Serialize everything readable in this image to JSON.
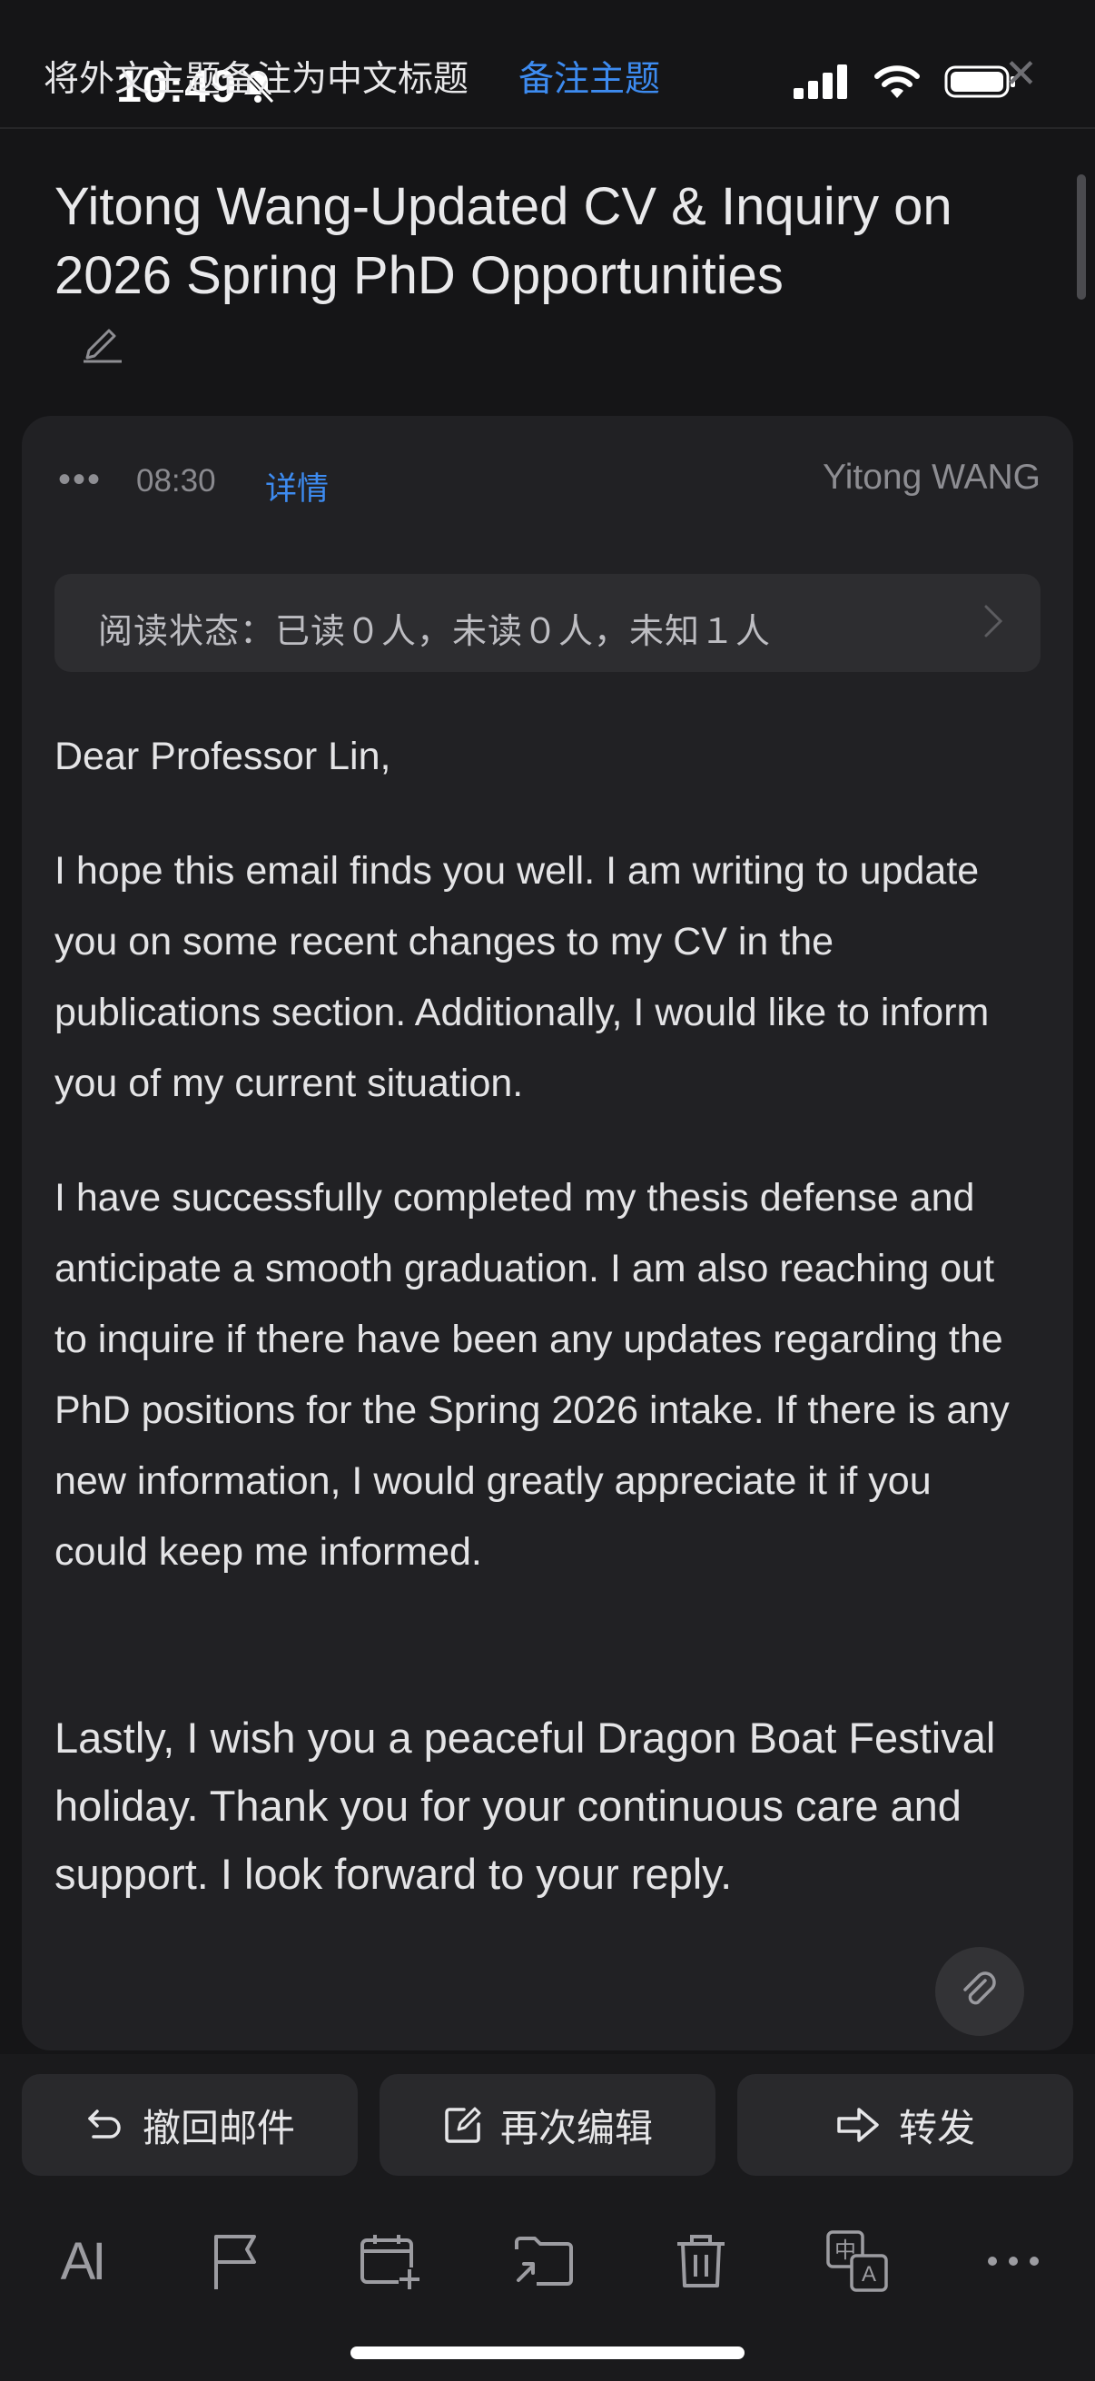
{
  "status_bar": {
    "time": "10:49",
    "icons": [
      "silent-bell-icon",
      "cellular-signal-icon",
      "wifi-icon",
      "battery-icon"
    ]
  },
  "translate_banner": {
    "text": "将外文主题备注为中文标题",
    "action_label": "备注主题",
    "close_icon": "close-icon"
  },
  "email": {
    "subject": "Yitong Wang-Updated CV & Inquiry on 2026 Spring PhD Opportunities",
    "time": "08:30",
    "detail_label": "详情",
    "sender": "Yitong WANG",
    "read_status": "阅读状态：已读０人，未读０人，未知１人",
    "body": [
      "Dear Professor Lin,",
      "I hope this email finds you well. I am writing to update you on some recent changes to my CV in the publications section. Additionally, I would like to inform you of my current situation.",
      "I have successfully completed my thesis defense and anticipate a smooth graduation. I am also reaching out to inquire if there have been any updates regarding the PhD positions for the Spring 2026 intake. If there is any new information, I would greatly appreciate it if you could keep me informed.",
      "Lastly, I wish you a peaceful Dragon Boat Festival holiday. Thank you for your continuous care and support. I look forward to your reply."
    ]
  },
  "actions": {
    "recall_label": "撤回邮件",
    "edit_again_label": "再次编辑",
    "forward_label": "转发"
  },
  "toolbar": {
    "ai_label": "AI",
    "items": [
      "ai-icon",
      "flag-icon",
      "calendar-add-icon",
      "move-folder-icon",
      "trash-icon",
      "translate-icon",
      "more-icon"
    ]
  },
  "colors": {
    "background": "#151517",
    "card": "#212124",
    "accent": "#3d8bf0"
  }
}
